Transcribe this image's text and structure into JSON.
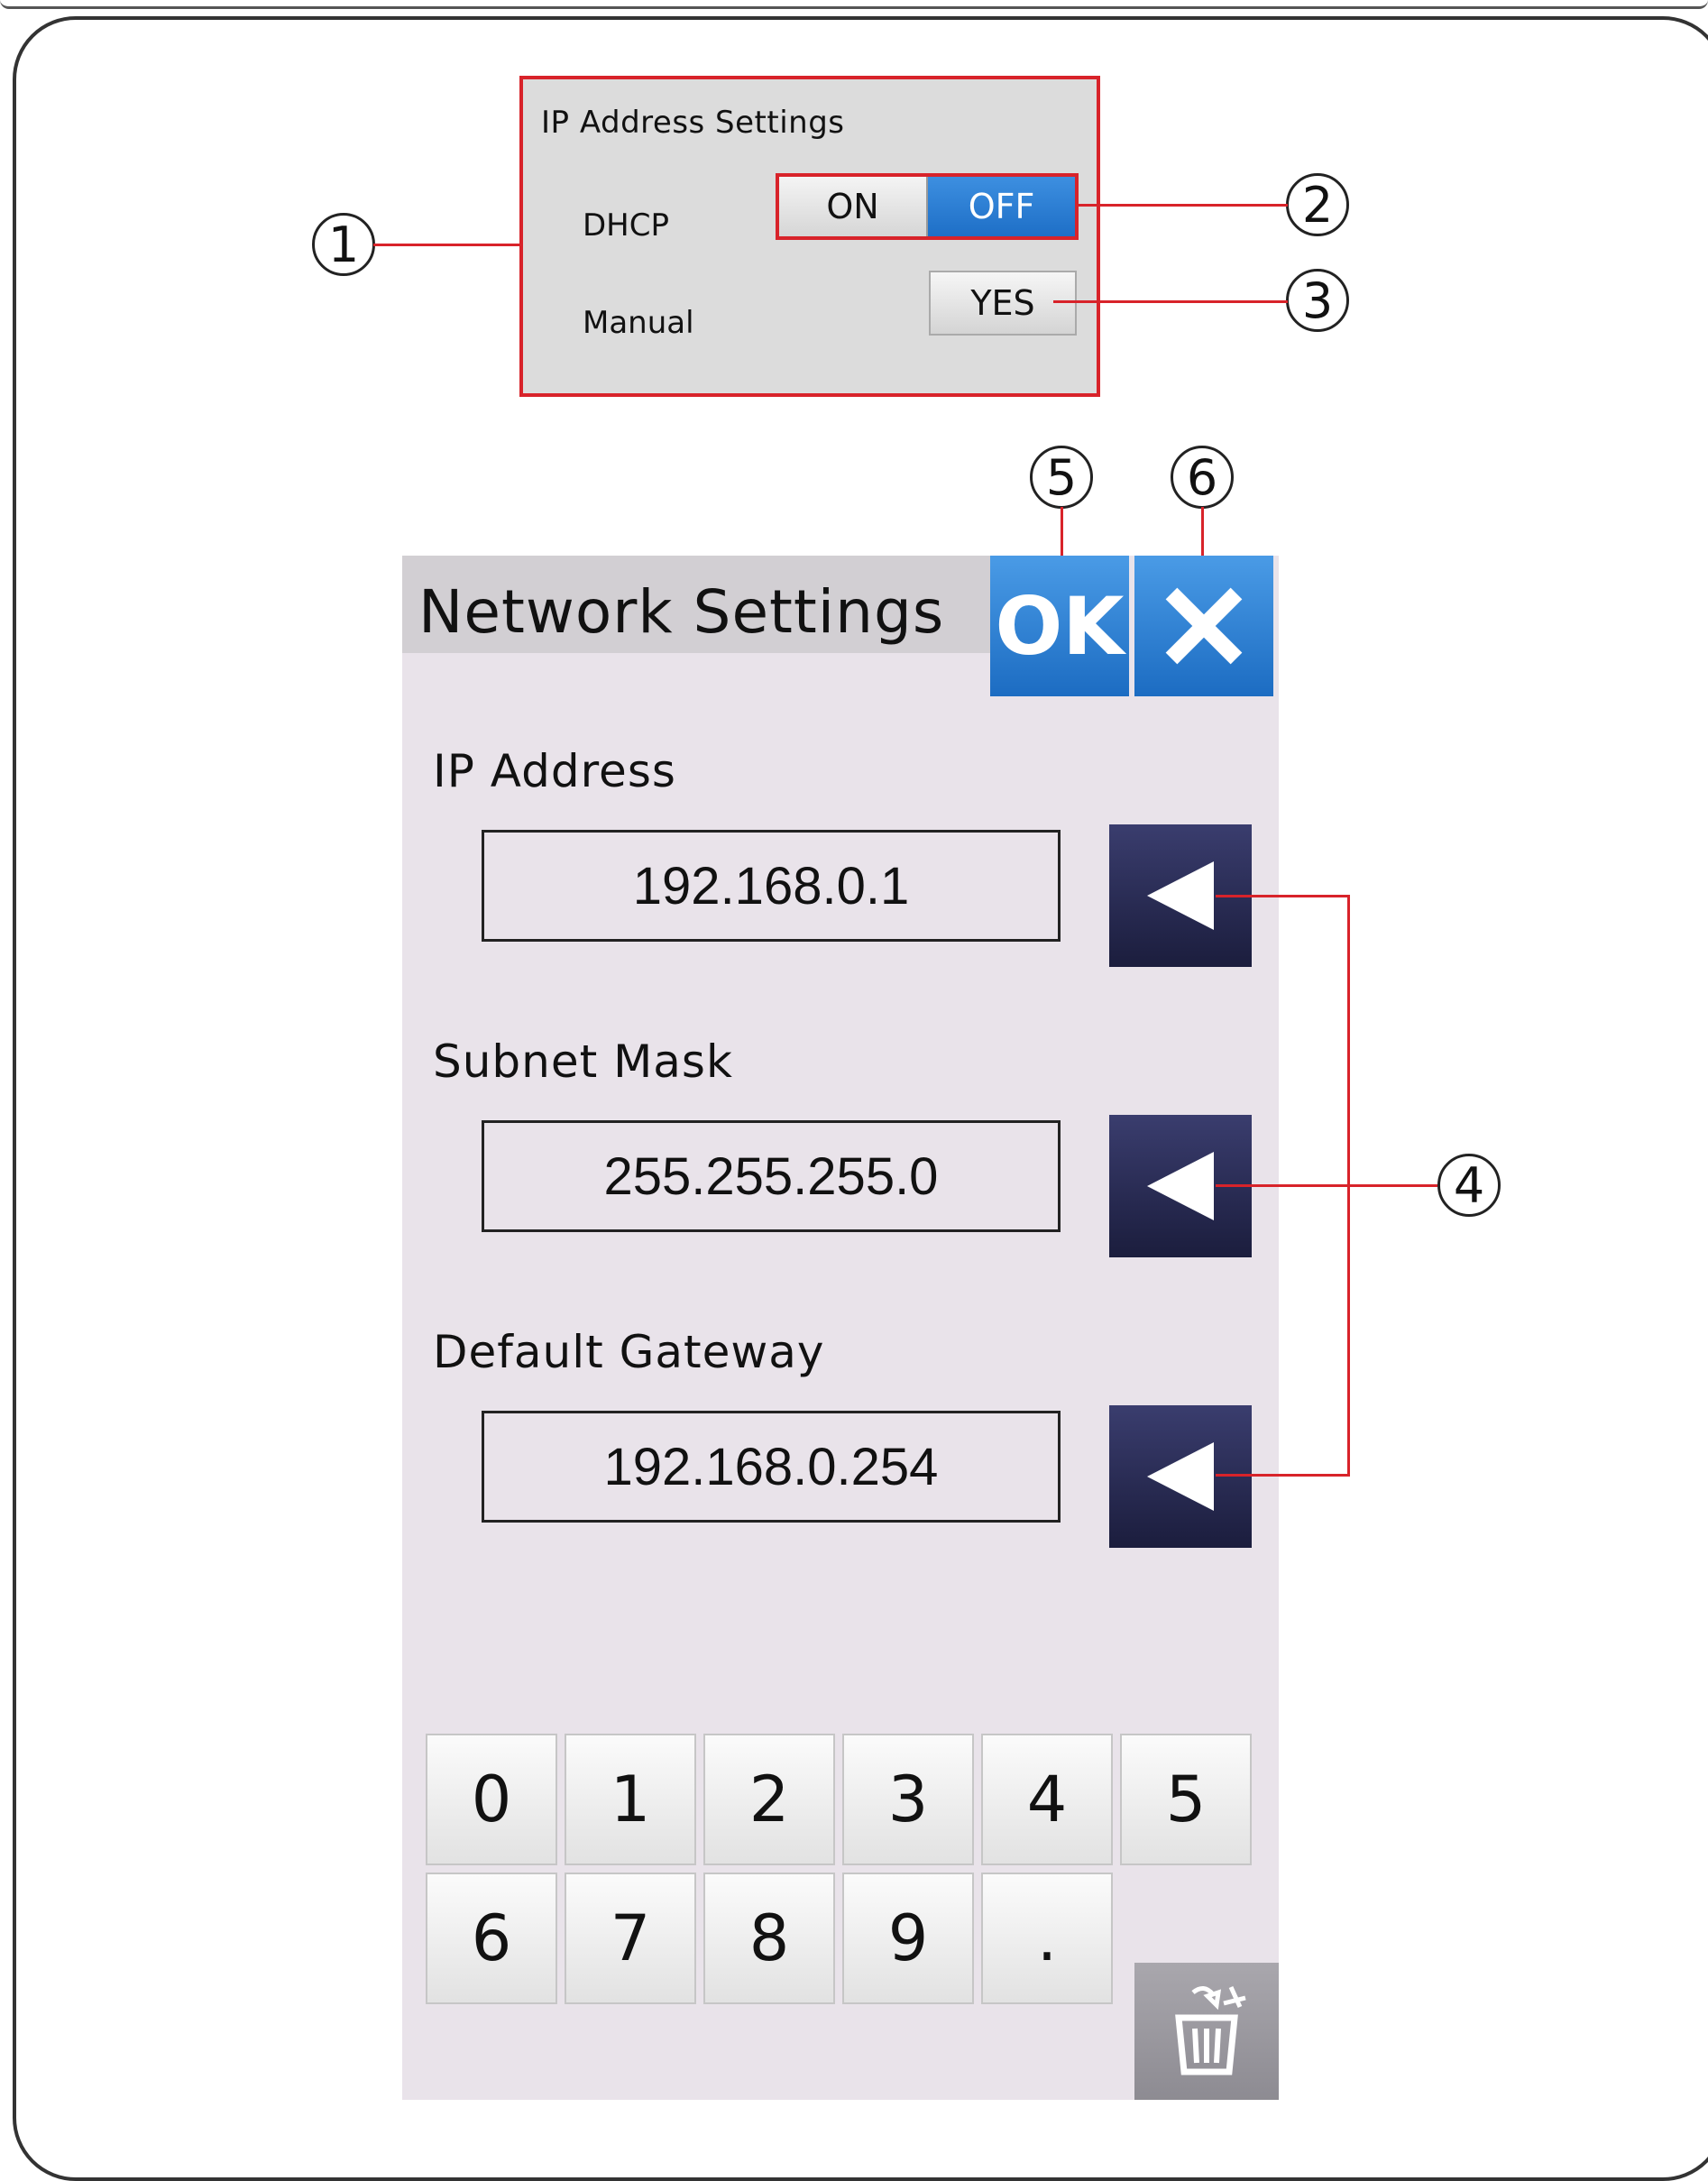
{
  "ip_panel": {
    "title": "IP Address Settings",
    "dhcp_label": "DHCP",
    "manual_label": "Manual",
    "dhcp_on_label": "ON",
    "dhcp_off_label": "OFF",
    "dhcp_selected": "OFF",
    "manual_button_label": "YES"
  },
  "callouts": {
    "c1": "1",
    "c2": "2",
    "c3": "3",
    "c4": "4",
    "c5": "5",
    "c6": "6"
  },
  "screen": {
    "title": "Network Settings",
    "ok_label": "OK",
    "cancel_icon": "close-icon",
    "fields": [
      {
        "label": "IP Address",
        "value": "192.168.0.1"
      },
      {
        "label": "Subnet Mask",
        "value": "255.255.255.0"
      },
      {
        "label": "Default Gateway",
        "value": "192.168.0.254"
      }
    ],
    "edit_icon": "left-arrow-icon",
    "keypad": [
      "0",
      "1",
      "2",
      "3",
      "4",
      "5",
      "6",
      "7",
      "8",
      "9",
      "."
    ],
    "clear_icon": "trash-icon"
  },
  "colors": {
    "accent_blue": "#1e6fc7",
    "callout_red": "#d8232a",
    "back_button": "#1b1d3d",
    "screen_bg": "#e9e3ea"
  }
}
